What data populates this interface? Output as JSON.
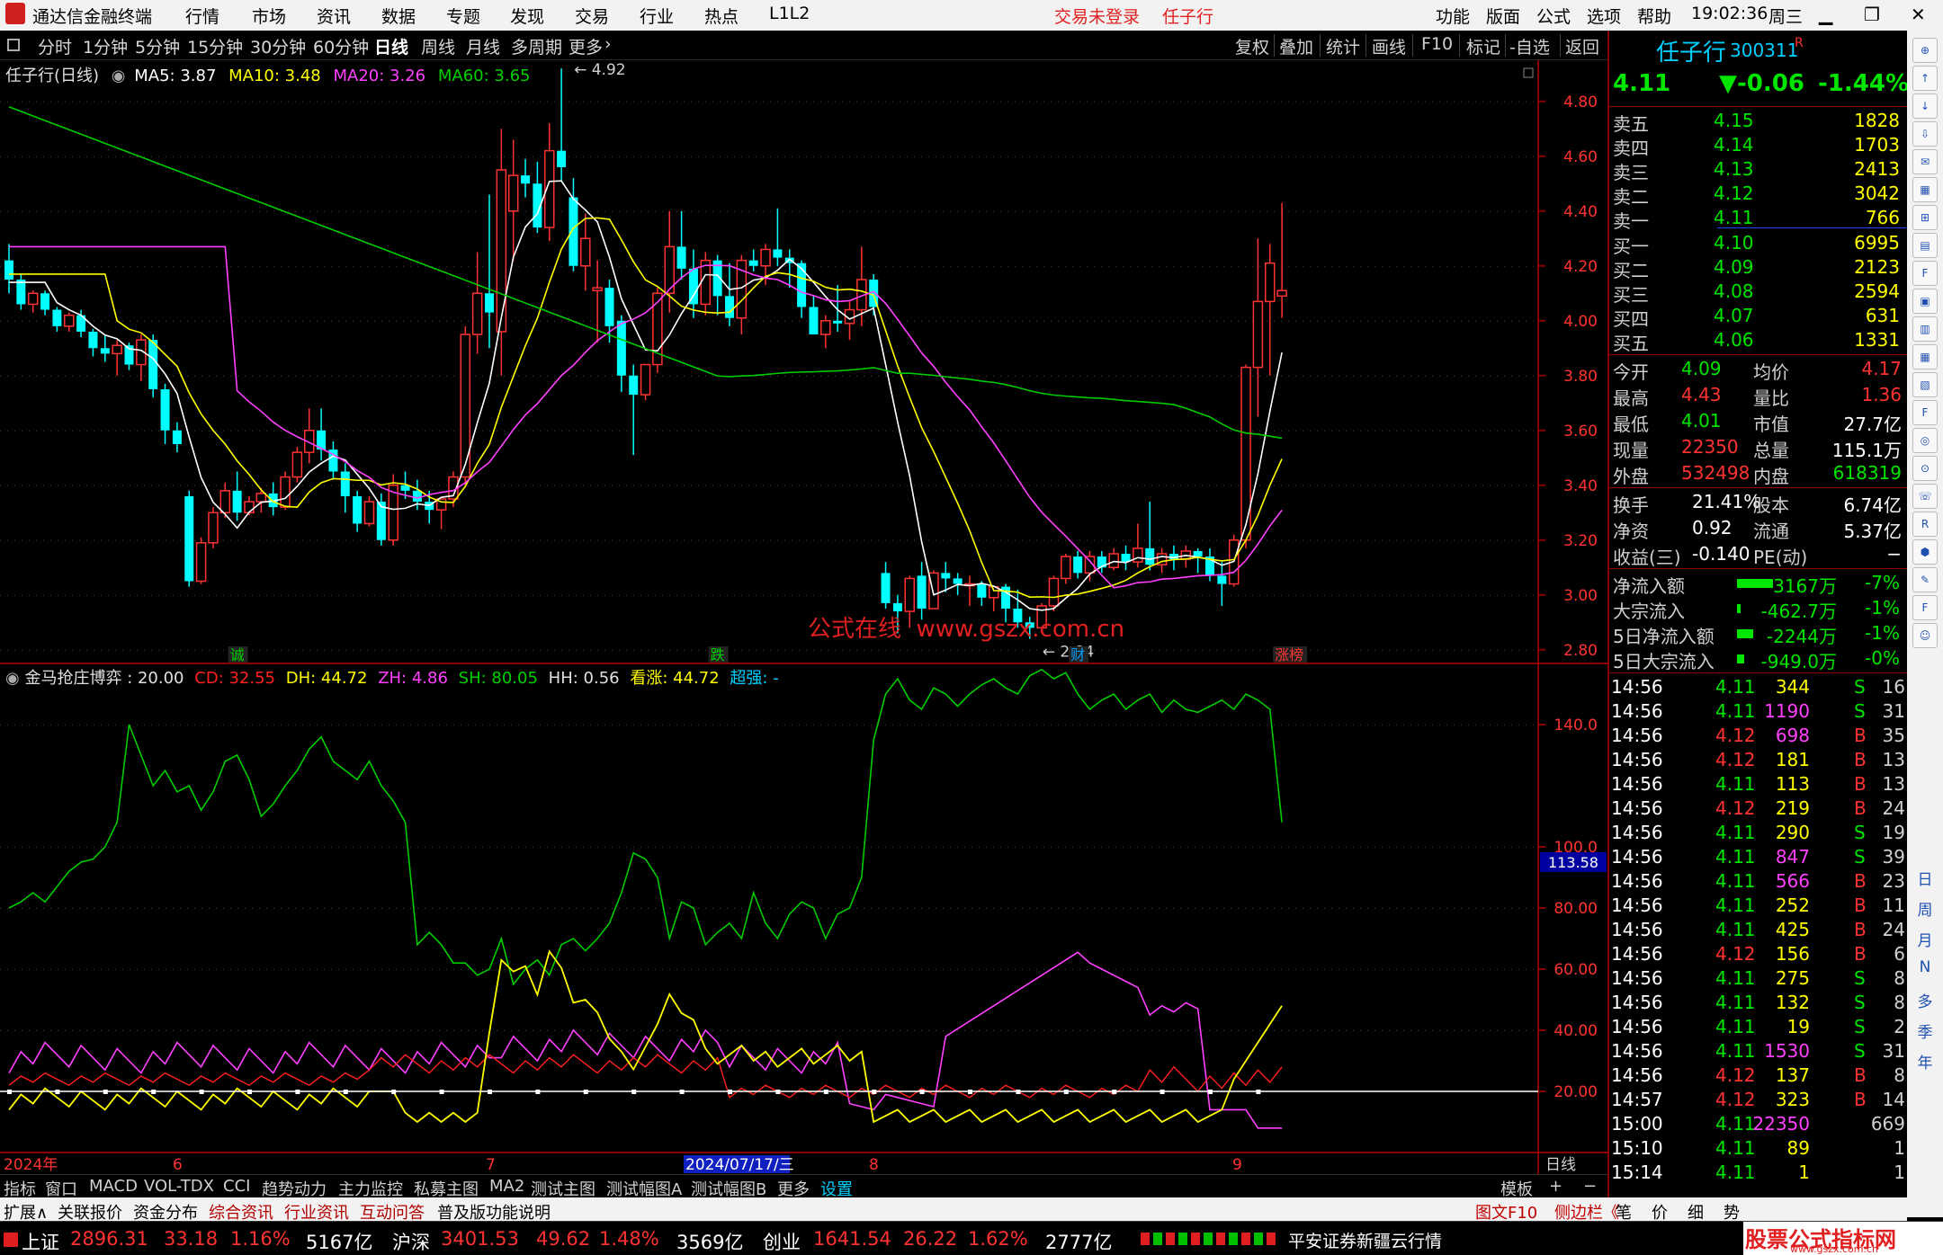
{
  "app": {
    "title": "通达信金融终端",
    "menus": [
      "行情",
      "市场",
      "资讯",
      "数据",
      "专题",
      "发现",
      "交易",
      "行业",
      "热点",
      "L1L2"
    ],
    "login": "交易未登录",
    "stock_name_top": "任子行",
    "right_menus": [
      "功能",
      "版面",
      "公式",
      "选项",
      "帮助"
    ],
    "time": "19:02:36",
    "weekday": "周三"
  },
  "periods": [
    "分时",
    "1分钟",
    "5分钟",
    "15分钟",
    "30分钟",
    "60分钟",
    "日线",
    "周线",
    "月线",
    "多周期",
    "更多"
  ],
  "tools": [
    "复权",
    "叠加",
    "统计",
    "画线",
    "F10",
    "标记",
    "-自选",
    "返回"
  ],
  "kline": {
    "title": "任子行(日线)",
    "ma5_label": "MA5: 3.87",
    "ma10_label": "MA10: 3.48",
    "ma20_label": "MA20: 3.26",
    "ma60_label": "MA60: 3.65",
    "high_mark": "4.92",
    "low_mark": "2.84",
    "watermark": "公式在线  www.gszx.com.cn",
    "events": [
      "诚",
      "跌",
      "财",
      "涨榜"
    ],
    "yticks": [
      "4.80",
      "4.60",
      "4.40",
      "4.20",
      "4.00",
      "3.80",
      "3.60",
      "3.40",
      "3.20",
      "3.00",
      "2.80"
    ]
  },
  "indicator": {
    "title": "金马抢庄博弈",
    "value_label": ": 20.00",
    "cd_label": "CD: 32.55",
    "dh_label": "DH: 44.72",
    "zh_label": "ZH: 4.86",
    "sh_label": "SH: 80.05",
    "hh_label": "HH: 0.56",
    "kz_label": "看涨: 44.72",
    "cq_label": "超强: -",
    "cursor_value": "113.58",
    "yticks": [
      "140.0",
      "100.0",
      "80.00",
      "60.00",
      "40.00",
      "20.00"
    ]
  },
  "xaxis": {
    "labels": [
      "2024年",
      "6",
      "7",
      "2024/07/17/三",
      "8",
      "9",
      "日线"
    ]
  },
  "tabs": [
    "指标",
    "窗口",
    "MACD",
    "VOL-TDX",
    "CCI",
    "趋势动力",
    "主力监控",
    "私募主图",
    "MA2",
    "测试主图",
    "测试幅图A",
    "测试幅图B",
    "更多",
    "设置",
    "模板",
    "+",
    "−"
  ],
  "tabs2": [
    "扩展∧",
    "关联报价",
    "资金分布",
    "综合资讯",
    "行业资讯",
    "互动问答",
    "普及版功能说明"
  ],
  "tabs2_right": [
    "图文F10",
    "侧边栏《",
    "笔",
    "价",
    "细",
    "势"
  ],
  "quote": {
    "name": "任子行",
    "code": "300311",
    "flag": "R",
    "price": "4.11",
    "change": "▼-0.06",
    "pct": "-1.44%",
    "sells": [
      {
        "label": "卖五",
        "price": "4.15",
        "vol": "1828"
      },
      {
        "label": "卖四",
        "price": "4.14",
        "vol": "1703"
      },
      {
        "label": "卖三",
        "price": "4.13",
        "vol": "2413"
      },
      {
        "label": "卖二",
        "price": "4.12",
        "vol": "3042"
      },
      {
        "label": "卖一",
        "price": "4.11",
        "vol": "766"
      }
    ],
    "buys": [
      {
        "label": "买一",
        "price": "4.10",
        "vol": "6995"
      },
      {
        "label": "买二",
        "price": "4.09",
        "vol": "2123"
      },
      {
        "label": "买三",
        "price": "4.08",
        "vol": "2594"
      },
      {
        "label": "买四",
        "price": "4.07",
        "vol": "631"
      },
      {
        "label": "买五",
        "price": "4.06",
        "vol": "1331"
      }
    ],
    "stats": [
      {
        "l1": "今开",
        "v1": "4.09",
        "l2": "均价",
        "v2": "4.17"
      },
      {
        "l1": "最高",
        "v1": "4.43",
        "l2": "量比",
        "v2": "1.36"
      },
      {
        "l1": "最低",
        "v1": "4.01",
        "l2": "市值",
        "v2": "27.7亿"
      },
      {
        "l1": "现量",
        "v1": "22350",
        "l2": "总量",
        "v2": "115.1万"
      },
      {
        "l1": "外盘",
        "v1": "532498",
        "l2": "内盘",
        "v2": "618319"
      }
    ],
    "stats2": [
      {
        "l1": "换手",
        "v1": "21.41%",
        "l2": "股本",
        "v2": "6.74亿"
      },
      {
        "l1": "净资",
        "v1": "0.92",
        "l2": "流通",
        "v2": "5.37亿"
      },
      {
        "l1": "收益(三)",
        "v1": "-0.140",
        "l2": "PE(动)",
        "v2": "−"
      }
    ],
    "flows": [
      {
        "label": "净流入额",
        "value": "-3167万",
        "pct": "-7%"
      },
      {
        "label": "大宗流入",
        "value": "-462.7万",
        "pct": "-1%"
      },
      {
        "label": "5日净流入额",
        "value": "-2244万",
        "pct": "-1%"
      },
      {
        "label": "5日大宗流入",
        "value": "-949.0万",
        "pct": "-0%"
      }
    ],
    "ticks": [
      [
        "14:56",
        "4.11",
        "344",
        "S",
        "16"
      ],
      [
        "14:56",
        "4.11",
        "1190",
        "S",
        "31"
      ],
      [
        "14:56",
        "4.12",
        "698",
        "B",
        "35"
      ],
      [
        "14:56",
        "4.12",
        "181",
        "B",
        "13"
      ],
      [
        "14:56",
        "4.11",
        "113",
        "B",
        "13"
      ],
      [
        "14:56",
        "4.12",
        "219",
        "B",
        "24"
      ],
      [
        "14:56",
        "4.11",
        "290",
        "S",
        "19"
      ],
      [
        "14:56",
        "4.11",
        "847",
        "S",
        "39"
      ],
      [
        "14:56",
        "4.11",
        "566",
        "B",
        "23"
      ],
      [
        "14:56",
        "4.11",
        "252",
        "B",
        "11"
      ],
      [
        "14:56",
        "4.11",
        "425",
        "B",
        "24"
      ],
      [
        "14:56",
        "4.12",
        "156",
        "B",
        "6"
      ],
      [
        "14:56",
        "4.11",
        "275",
        "S",
        "8"
      ],
      [
        "14:56",
        "4.11",
        "132",
        "S",
        "8"
      ],
      [
        "14:56",
        "4.11",
        "19",
        "S",
        "2"
      ],
      [
        "14:56",
        "4.11",
        "1530",
        "S",
        "31"
      ],
      [
        "14:56",
        "4.12",
        "137",
        "B",
        "8"
      ],
      [
        "14:57",
        "4.12",
        "323",
        "B",
        "14"
      ],
      [
        "15:00",
        "4.11",
        "22350",
        "",
        "669"
      ],
      [
        "15:10",
        "4.11",
        "89",
        "",
        "1"
      ],
      [
        "15:14",
        "4.11",
        "1",
        "",
        "1"
      ]
    ]
  },
  "sidebar_chars": [
    "日",
    "周",
    "月",
    "N",
    "多",
    "季",
    "年"
  ],
  "status": {
    "sh_label": "上证",
    "sh_val": "2896.31",
    "sh_chg": "33.18",
    "sh_pct": "1.16%",
    "sh_amt": "5167亿",
    "sz_label": "沪深",
    "sz_val": "3401.53",
    "sz_chg": "49.62",
    "sz_pct": "1.48%",
    "sz_amt": "3569亿",
    "cy_label": "创业",
    "cy_val": "1641.54",
    "cy_chg": "26.22",
    "cy_pct": "1.62%",
    "cy_amt": "2777亿",
    "broker": "平安证券新疆云行情",
    "brand": "股票公式指标网",
    "brand_url": "www.gszx.com.cn"
  },
  "colors": {
    "up": "#ff3232",
    "down": "#00ffff",
    "ma5": "#ffffff",
    "ma10": "#ffff00",
    "ma20": "#ff40ff",
    "ma60": "#00cc00",
    "axis": "#8b0000"
  },
  "chart_data": {
    "type": "candlestick",
    "candles": [
      [
        4.22,
        4.28,
        4.1,
        4.15
      ],
      [
        4.15,
        4.17,
        4.04,
        4.06
      ],
      [
        4.06,
        4.11,
        4.03,
        4.1
      ],
      [
        4.1,
        4.11,
        4.02,
        4.04
      ],
      [
        4.04,
        4.05,
        3.96,
        3.98
      ],
      [
        3.98,
        4.03,
        3.96,
        4.02
      ],
      [
        4.02,
        4.04,
        3.94,
        3.96
      ],
      [
        3.96,
        3.97,
        3.87,
        3.9
      ],
      [
        3.9,
        3.95,
        3.85,
        3.88
      ],
      [
        3.88,
        3.93,
        3.8,
        3.91
      ],
      [
        3.91,
        3.92,
        3.82,
        3.84
      ],
      [
        3.84,
        3.95,
        3.78,
        3.93
      ],
      [
        3.93,
        3.95,
        3.72,
        3.75
      ],
      [
        3.75,
        3.77,
        3.55,
        3.6
      ],
      [
        3.6,
        3.63,
        3.52,
        3.55
      ],
      [
        3.36,
        3.38,
        3.03,
        3.05
      ],
      [
        3.05,
        3.21,
        3.04,
        3.19
      ],
      [
        3.19,
        3.32,
        3.17,
        3.3
      ],
      [
        3.3,
        3.41,
        3.28,
        3.38
      ],
      [
        3.38,
        3.45,
        3.27,
        3.3
      ],
      [
        3.3,
        3.36,
        3.29,
        3.34
      ],
      [
        3.34,
        3.39,
        3.3,
        3.37
      ],
      [
        3.37,
        3.41,
        3.29,
        3.32
      ],
      [
        3.32,
        3.45,
        3.31,
        3.43
      ],
      [
        3.43,
        3.54,
        3.41,
        3.52
      ],
      [
        3.52,
        3.68,
        3.48,
        3.6
      ],
      [
        3.6,
        3.68,
        3.49,
        3.53
      ],
      [
        3.53,
        3.56,
        3.42,
        3.45
      ],
      [
        3.45,
        3.48,
        3.3,
        3.36
      ],
      [
        3.36,
        3.38,
        3.23,
        3.26
      ],
      [
        3.26,
        3.36,
        3.25,
        3.34
      ],
      [
        3.34,
        3.37,
        3.18,
        3.2
      ],
      [
        3.2,
        3.44,
        3.18,
        3.4
      ],
      [
        3.4,
        3.45,
        3.35,
        3.38
      ],
      [
        3.38,
        3.42,
        3.31,
        3.34
      ],
      [
        3.34,
        3.38,
        3.26,
        3.31
      ],
      [
        3.31,
        3.34,
        3.24,
        3.35
      ],
      [
        3.35,
        3.45,
        3.32,
        3.43
      ],
      [
        3.43,
        3.98,
        3.4,
        3.95
      ],
      [
        3.95,
        4.25,
        3.88,
        4.1
      ],
      [
        4.1,
        4.46,
        3.9,
        4.03
      ],
      [
        3.96,
        4.7,
        3.8,
        4.55
      ],
      [
        4.4,
        4.66,
        4.22,
        4.53
      ],
      [
        4.53,
        4.59,
        4.45,
        4.5
      ],
      [
        4.5,
        4.58,
        4.32,
        4.34
      ],
      [
        4.34,
        4.72,
        4.29,
        4.62
      ],
      [
        4.62,
        4.92,
        4.51,
        4.56
      ],
      [
        4.45,
        4.52,
        4.18,
        4.2
      ],
      [
        4.2,
        4.39,
        4.11,
        4.3
      ],
      [
        4.11,
        4.22,
        3.92,
        4.12
      ],
      [
        4.12,
        4.15,
        3.92,
        3.98
      ],
      [
        4.0,
        4.02,
        3.74,
        3.8
      ],
      [
        3.8,
        3.84,
        3.51,
        3.73
      ],
      [
        3.73,
        3.84,
        3.71,
        3.84
      ],
      [
        3.84,
        4.12,
        3.81,
        4.1
      ],
      [
        4.1,
        4.4,
        4.03,
        4.27
      ],
      [
        4.27,
        4.4,
        4.15,
        4.19
      ],
      [
        4.19,
        4.26,
        4.01,
        4.06
      ],
      [
        4.06,
        4.25,
        4.02,
        4.22
      ],
      [
        4.22,
        4.24,
        4.02,
        4.09
      ],
      [
        4.09,
        4.21,
        3.98,
        4.01
      ],
      [
        4.01,
        4.24,
        3.95,
        4.22
      ],
      [
        4.22,
        4.26,
        4.18,
        4.2
      ],
      [
        4.2,
        4.28,
        4.13,
        4.26
      ],
      [
        4.26,
        4.41,
        4.2,
        4.23
      ],
      [
        4.23,
        4.26,
        4.12,
        4.21
      ],
      [
        4.21,
        4.22,
        4.01,
        4.05
      ],
      [
        4.05,
        4.09,
        3.95,
        3.95
      ],
      [
        3.95,
        4.02,
        3.9,
        4.0
      ],
      [
        4.0,
        4.13,
        3.96,
        3.99
      ],
      [
        3.99,
        4.07,
        3.93,
        4.04
      ],
      [
        4.04,
        4.27,
        3.98,
        4.15
      ],
      [
        4.15,
        4.17,
        4.02,
        4.05
      ],
      [
        3.08,
        3.12,
        2.95,
        2.97
      ],
      [
        2.97,
        3.0,
        2.86,
        2.94
      ],
      [
        2.94,
        3.07,
        2.88,
        3.06
      ],
      [
        3.07,
        3.12,
        2.91,
        2.95
      ],
      [
        2.95,
        3.09,
        2.96,
        3.08
      ],
      [
        3.08,
        3.12,
        3.01,
        3.06
      ],
      [
        3.06,
        3.08,
        3.0,
        3.04
      ],
      [
        3.04,
        3.07,
        2.96,
        3.04
      ],
      [
        3.04,
        3.05,
        2.96,
        2.99
      ],
      [
        2.99,
        3.03,
        2.94,
        3.03
      ],
      [
        3.03,
        3.04,
        2.9,
        2.95
      ],
      [
        2.95,
        3.02,
        2.88,
        2.9
      ],
      [
        2.9,
        2.92,
        2.84,
        2.88
      ],
      [
        2.88,
        2.97,
        2.86,
        2.96
      ],
      [
        2.96,
        3.07,
        2.94,
        3.06
      ],
      [
        3.06,
        3.15,
        3.04,
        3.14
      ],
      [
        3.14,
        3.16,
        3.06,
        3.08
      ],
      [
        3.08,
        3.16,
        3.05,
        3.14
      ],
      [
        3.14,
        3.16,
        3.08,
        3.1
      ],
      [
        3.1,
        3.17,
        3.09,
        3.15
      ],
      [
        3.15,
        3.18,
        3.09,
        3.12
      ],
      [
        3.12,
        3.26,
        3.1,
        3.17
      ],
      [
        3.17,
        3.34,
        3.09,
        3.11
      ],
      [
        3.11,
        3.17,
        3.08,
        3.15
      ],
      [
        3.15,
        3.18,
        3.09,
        3.13
      ],
      [
        3.13,
        3.18,
        3.1,
        3.16
      ],
      [
        3.16,
        3.17,
        3.08,
        3.14
      ],
      [
        3.14,
        3.17,
        3.05,
        3.07
      ],
      [
        3.07,
        3.12,
        2.96,
        3.04
      ],
      [
        3.04,
        3.22,
        3.03,
        3.2
      ],
      [
        3.2,
        3.84,
        3.17,
        3.83
      ],
      [
        3.83,
        4.3,
        3.65,
        4.07
      ],
      [
        4.07,
        4.28,
        3.8,
        4.21
      ],
      [
        4.09,
        4.43,
        4.01,
        4.11
      ]
    ],
    "ylim": [
      2.75,
      4.95
    ]
  }
}
